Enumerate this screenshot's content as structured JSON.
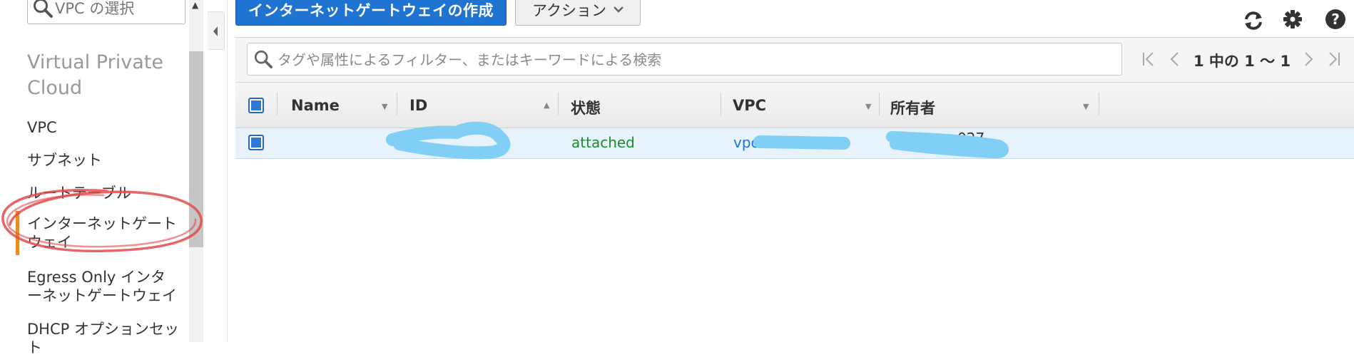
{
  "sidebar": {
    "vpc_select_placeholder": "VPC の選択",
    "heading": "Virtual Private Cloud",
    "items": [
      {
        "label": "VPC"
      },
      {
        "label": "サブネット"
      },
      {
        "label": "ルートテーブル"
      },
      {
        "label": "インターネットゲートウェイ",
        "active": true
      },
      {
        "label": "Egress Only インターネットゲートウェイ"
      },
      {
        "label": "DHCP オプションセット"
      }
    ]
  },
  "toolbar": {
    "create_label": "インターネットゲートウェイの作成",
    "action_label": "アクション",
    "refresh_icon": "refresh-icon",
    "settings_icon": "gear-icon",
    "help_icon": "help-icon"
  },
  "filter": {
    "placeholder": "タグや属性によるフィルター、またはキーワードによる検索"
  },
  "pagination": {
    "text": "1 中の 1 ～ 1"
  },
  "table": {
    "columns": [
      "Name",
      "ID",
      "状態",
      "VPC",
      "所有者"
    ],
    "rows": [
      {
        "name": "",
        "id": "",
        "state": "attached",
        "vpc": "vpc",
        "owner": "027"
      }
    ]
  },
  "colors": {
    "primary": "#1f73d1",
    "active_marker": "#e88d23",
    "state_green": "#1d8a2e",
    "row_selected": "#e8f2fb"
  }
}
